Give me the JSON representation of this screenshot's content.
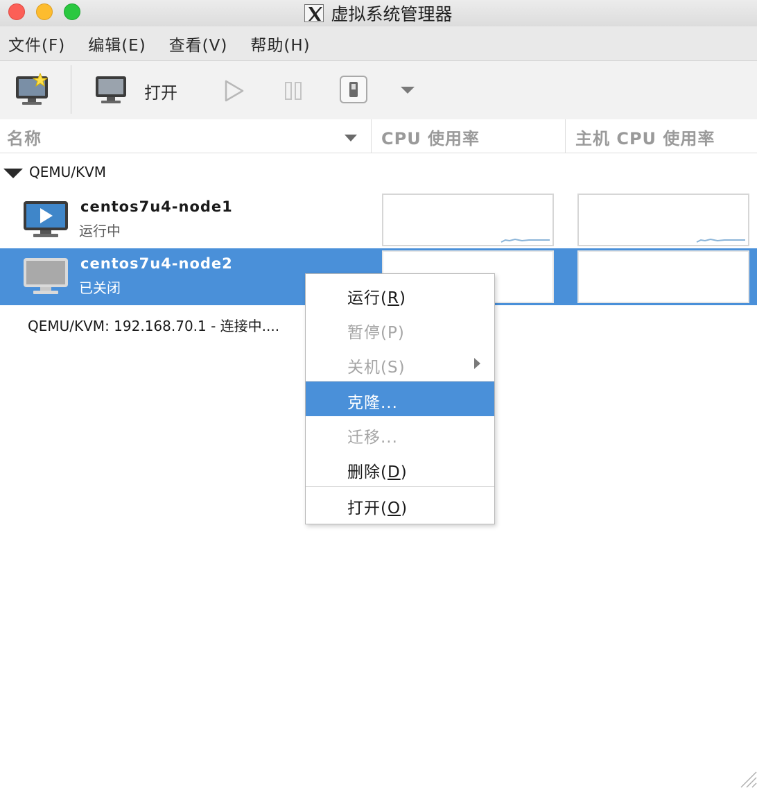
{
  "window": {
    "title": "虚拟系统管理器"
  },
  "menubar": {
    "items": [
      {
        "label": "文件(F)"
      },
      {
        "label": "编辑(E)"
      },
      {
        "label": "查看(V)"
      },
      {
        "label": "帮助(H)"
      }
    ]
  },
  "toolbar": {
    "new_vm_icon": "new-vm-icon",
    "open_label": "打开",
    "open_icon": "monitor-icon",
    "run_icon": "play-icon",
    "pause_icon": "pause-icon",
    "shutdown_icon": "power-icon",
    "dropdown_icon": "chevron-down-icon"
  },
  "columns": {
    "name": "名称",
    "cpu": "CPU 使用率",
    "host_cpu": "主机 CPU 使用率"
  },
  "tree": {
    "group_label": "QEMU/KVM",
    "vms": [
      {
        "name": "centos7u4-node1",
        "status": "运行中",
        "selected": false
      },
      {
        "name": "centos7u4-node2",
        "status": "已关闭",
        "selected": true
      }
    ],
    "connection_status": "QEMU/KVM: 192.168.70.1 - 连接中...."
  },
  "context_menu": {
    "items": [
      {
        "pre": "运行(",
        "key": "R",
        "post": ")",
        "disabled": false
      },
      {
        "pre": "暂停(",
        "key": "P",
        "post": ")",
        "disabled": true
      },
      {
        "pre": "关机(",
        "key": "S",
        "post": ")",
        "disabled": true,
        "submenu": true
      },
      {
        "label": "克隆...",
        "active": true
      },
      {
        "label": "迁移...",
        "disabled": true
      },
      {
        "pre": "删除(",
        "key": "D",
        "post": ")",
        "disabled": false
      },
      {
        "pre": "打开(",
        "key": "O",
        "post": ")",
        "disabled": false
      }
    ]
  },
  "colors": {
    "selection": "#4a90d9",
    "disabled_text": "#a5a5a5",
    "graph_line": "#8ab4d8"
  }
}
